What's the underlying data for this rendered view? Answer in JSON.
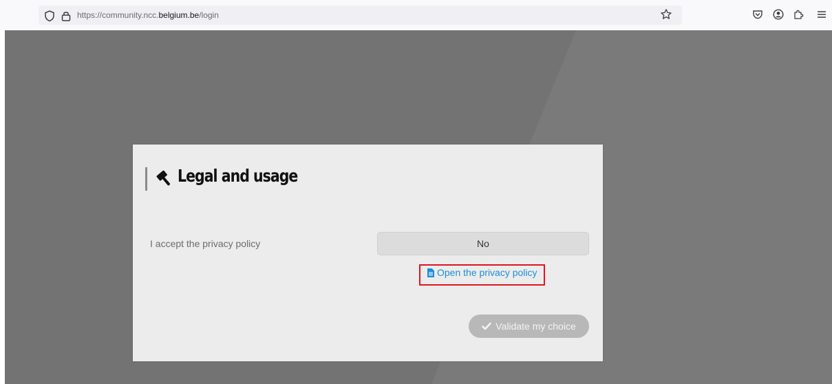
{
  "browser": {
    "url_prefix": "https://community.ncc.",
    "url_domain": "belgium.be",
    "url_path": "/login",
    "icons": [
      "shield-icon",
      "lock-icon",
      "star-icon",
      "pocket-icon",
      "account-icon",
      "extensions-icon",
      "menu-icon"
    ]
  },
  "modal": {
    "title": "Legal and usage",
    "title_icon": "gavel-icon",
    "field_label": "I accept the privacy policy",
    "choice_value": "No",
    "policy_link": "Open the privacy policy",
    "policy_link_icon": "document-icon",
    "validate_label": "Validate my choice",
    "validate_icon": "check-icon"
  },
  "colors": {
    "overlay": "#737373",
    "link": "#1a8fd8",
    "highlight": "#e0141e",
    "validate_disabled": "#b8b8b8"
  }
}
